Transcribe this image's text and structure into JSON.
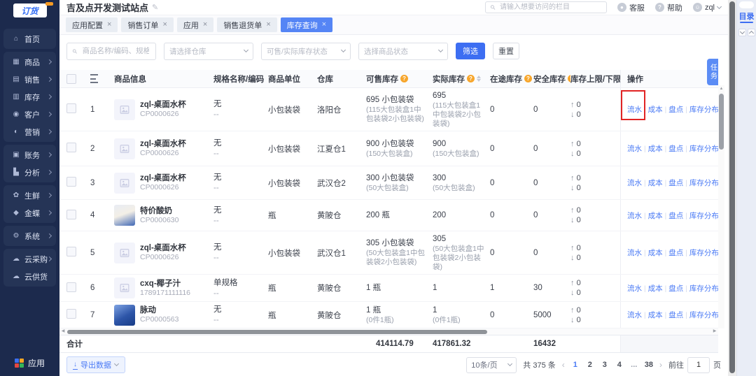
{
  "colors": {
    "accent": "#3d6ef2",
    "sidebar_bg": "#1c2a4d",
    "active_tab": "#5585f5",
    "link": "#4a7af5",
    "help_icon": "#f7a62c",
    "annotation": "#e12424"
  },
  "brand": {
    "logo_text": "订货"
  },
  "topbar": {
    "site_title": "吉及点开发测试站点",
    "search_placeholder": "请输入想要访问的栏目",
    "service_label": "客服",
    "help_label": "帮助",
    "user_name": "zql"
  },
  "sidebar": {
    "groups": [
      [
        {
          "icon": "home-icon",
          "label": "首页",
          "arrow": false
        }
      ],
      [
        {
          "icon": "goods-icon",
          "label": "商品",
          "arrow": true
        },
        {
          "icon": "sales-icon",
          "label": "销售",
          "arrow": true
        },
        {
          "icon": "inventory-icon",
          "label": "库存",
          "arrow": true
        },
        {
          "icon": "customer-icon",
          "label": "客户",
          "arrow": true
        },
        {
          "icon": "marketing-icon",
          "label": "营销",
          "arrow": true
        }
      ],
      [
        {
          "icon": "finance-icon",
          "label": "账务",
          "arrow": true
        },
        {
          "icon": "analytics-icon",
          "label": "分析",
          "arrow": true
        }
      ],
      [
        {
          "icon": "fresh-icon",
          "label": "生鲜",
          "arrow": true
        },
        {
          "icon": "kingdee-icon",
          "label": "金蝶",
          "arrow": true
        }
      ],
      [
        {
          "icon": "system-icon",
          "label": "系统",
          "arrow": true
        }
      ],
      [
        {
          "icon": "cloud-purchase-icon",
          "label": "云采购",
          "arrow": true
        },
        {
          "icon": "cloud-supply-icon",
          "label": "云供货",
          "arrow": false
        }
      ]
    ],
    "apps_label": "应用"
  },
  "tabs": [
    {
      "label": "应用配置",
      "active": false
    },
    {
      "label": "销售订单",
      "active": false
    },
    {
      "label": "应用",
      "active": false
    },
    {
      "label": "销售退货单",
      "active": false
    },
    {
      "label": "库存查询",
      "active": true
    }
  ],
  "filters": {
    "keyword_placeholder": "商品名称/编码、规格名称",
    "warehouse_placeholder": "请选择仓库",
    "stock_status_placeholder": "可售/实际库存状态",
    "product_status_placeholder": "选择商品状态",
    "filter_label": "筛选",
    "reset_label": "重置"
  },
  "table": {
    "columns": {
      "product": "商品信息",
      "spec": "规格名称/编码",
      "unit": "商品单位",
      "warehouse": "仓库",
      "sellable": "可售库存",
      "actual": "实际库存",
      "transit": "在途库存",
      "safety": "安全库存",
      "limits": "库存上限/下限",
      "ops": "操作"
    },
    "ops": [
      "流水",
      "成本",
      "盘点",
      "库存分布"
    ],
    "rows": [
      {
        "index": "1",
        "name": "zql-桌面水杯",
        "code": "CP0000626",
        "image": "placeholder",
        "spec": "无",
        "spec_sub": "--",
        "unit": "小包装袋",
        "warehouse": "洛阳仓",
        "sellable": "695 小包装袋",
        "sellable_desc": "(115大包装盒1中包装袋2小包装袋)",
        "actual": "695",
        "actual_desc": "(115大包装盒1中包装袋2小包装袋)",
        "transit": "0",
        "safety": "0",
        "upper": "0",
        "lower": "0"
      },
      {
        "index": "2",
        "name": "zql-桌面水杯",
        "code": "CP0000626",
        "image": "placeholder",
        "spec": "无",
        "spec_sub": "--",
        "unit": "小包装袋",
        "warehouse": "江夏仓1",
        "sellable": "900 小包装袋",
        "sellable_desc": "(150大包装盒)",
        "actual": "900",
        "actual_desc": "(150大包装盒)",
        "transit": "0",
        "safety": "0",
        "upper": "0",
        "lower": "0"
      },
      {
        "index": "3",
        "name": "zql-桌面水杯",
        "code": "CP0000626",
        "image": "placeholder",
        "spec": "无",
        "spec_sub": "--",
        "unit": "小包装袋",
        "warehouse": "武汉仓2",
        "sellable": "300 小包装袋",
        "sellable_desc": "(50大包装盒)",
        "actual": "300",
        "actual_desc": "(50大包装盒)",
        "transit": "0",
        "safety": "0",
        "upper": "0",
        "lower": "0"
      },
      {
        "index": "4",
        "name": "特价酸奶",
        "code": "CP0000630",
        "image": "photo-yogurt",
        "spec": "无",
        "spec_sub": "--",
        "unit": "瓶",
        "warehouse": "黄陂仓",
        "sellable": "200 瓶",
        "sellable_desc": "",
        "actual": "200",
        "actual_desc": "",
        "transit": "0",
        "safety": "0",
        "upper": "0",
        "lower": "0"
      },
      {
        "index": "5",
        "name": "zql-桌面水杯",
        "code": "CP0000626",
        "image": "placeholder",
        "spec": "无",
        "spec_sub": "--",
        "unit": "小包装袋",
        "warehouse": "武汉仓1",
        "sellable": "305 小包装袋",
        "sellable_desc": "(50大包装盒1中包装袋2小包装袋)",
        "actual": "305",
        "actual_desc": "(50大包装盒1中包装袋2小包装袋)",
        "transit": "0",
        "safety": "0",
        "upper": "0",
        "lower": "0"
      },
      {
        "index": "6",
        "name": "cxq-椰子汁",
        "code": "1789171111116",
        "image": "placeholder",
        "spec": "单规格",
        "spec_sub": "--",
        "unit": "瓶",
        "warehouse": "黄陂仓",
        "sellable": "1 瓶",
        "sellable_desc": "",
        "actual": "1",
        "actual_desc": "",
        "transit": "1",
        "safety": "30",
        "upper": "0",
        "lower": "0"
      },
      {
        "index": "7",
        "name": "脉动",
        "code": "CP0000563",
        "image": "photo-bottles",
        "spec": "无",
        "spec_sub": "--",
        "unit": "瓶",
        "warehouse": "黄陂仓",
        "sellable": "1 瓶",
        "sellable_desc": "(0件1瓶)",
        "actual": "1",
        "actual_desc": "(0件1瓶)",
        "transit": "0",
        "safety": "5000",
        "upper": "0",
        "lower": "0"
      }
    ],
    "summary": {
      "label": "合计",
      "sellable": "414114.79",
      "actual": "417861.32",
      "safety": "16432"
    }
  },
  "footer": {
    "export_label": "导出数据",
    "page_size": "10条/页",
    "total_label": "共 375 条",
    "pages": [
      "1",
      "2",
      "3",
      "4",
      "...",
      "38"
    ],
    "current_page": "1",
    "goto_label": "前往",
    "goto_value": "1",
    "goto_unit": "页"
  },
  "right_panel": {
    "task_tab": "任务",
    "directory_label": "目录"
  }
}
